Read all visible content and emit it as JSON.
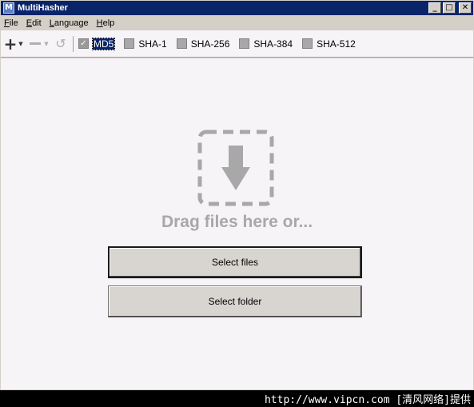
{
  "window": {
    "title": "MultiHasher",
    "icon_letter": "M",
    "controls": {
      "minimize": "_",
      "maximize": "□",
      "close": "✕"
    }
  },
  "menu": [
    {
      "label_u": "F",
      "label_rest": "ile"
    },
    {
      "label_u": "E",
      "label_rest": "dit"
    },
    {
      "label_u": "L",
      "label_rest": "anguage"
    },
    {
      "label_u": "H",
      "label_rest": "elp"
    }
  ],
  "toolbar": {
    "add_icon": "plus-icon",
    "remove_icon": "minus-icon",
    "refresh_icon": "refresh-icon",
    "hashes": [
      {
        "label": "MD5",
        "checked": true
      },
      {
        "label": "SHA-1",
        "checked": false
      },
      {
        "label": "SHA-256",
        "checked": false
      },
      {
        "label": "SHA-384",
        "checked": false
      },
      {
        "label": "SHA-512",
        "checked": false
      }
    ]
  },
  "main": {
    "drop_text": "Drag files here or...",
    "select_files_label": "Select files",
    "select_folder_label": "Select folder"
  },
  "watermark": "http://www.vipcn.com [清风网络]提供",
  "colors": {
    "titlebar": "#0a246a",
    "content_bg": "#f7f4f7",
    "drop_gray": "#a8a8a8"
  }
}
